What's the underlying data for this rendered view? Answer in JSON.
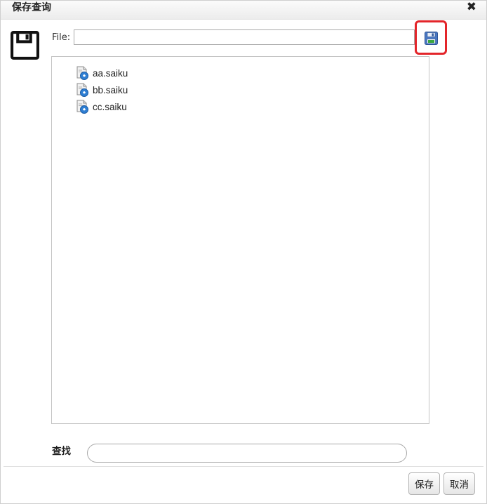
{
  "dialog": {
    "title": "保存查询",
    "close_glyph": "✖"
  },
  "file_field": {
    "label": "File:",
    "value": "",
    "placeholder": ""
  },
  "icons": {
    "large": "floppy-disk-icon",
    "save_button": "floppy-disk-icon",
    "file": "saiku-file-icon",
    "accent_highlight": "#e3252a"
  },
  "files": [
    {
      "name": "aa.saiku"
    },
    {
      "name": "bb.saiku"
    },
    {
      "name": "cc.saiku"
    }
  ],
  "search": {
    "label": "查找",
    "value": "",
    "placeholder": ""
  },
  "buttons": {
    "save": "保存",
    "cancel": "取消"
  }
}
